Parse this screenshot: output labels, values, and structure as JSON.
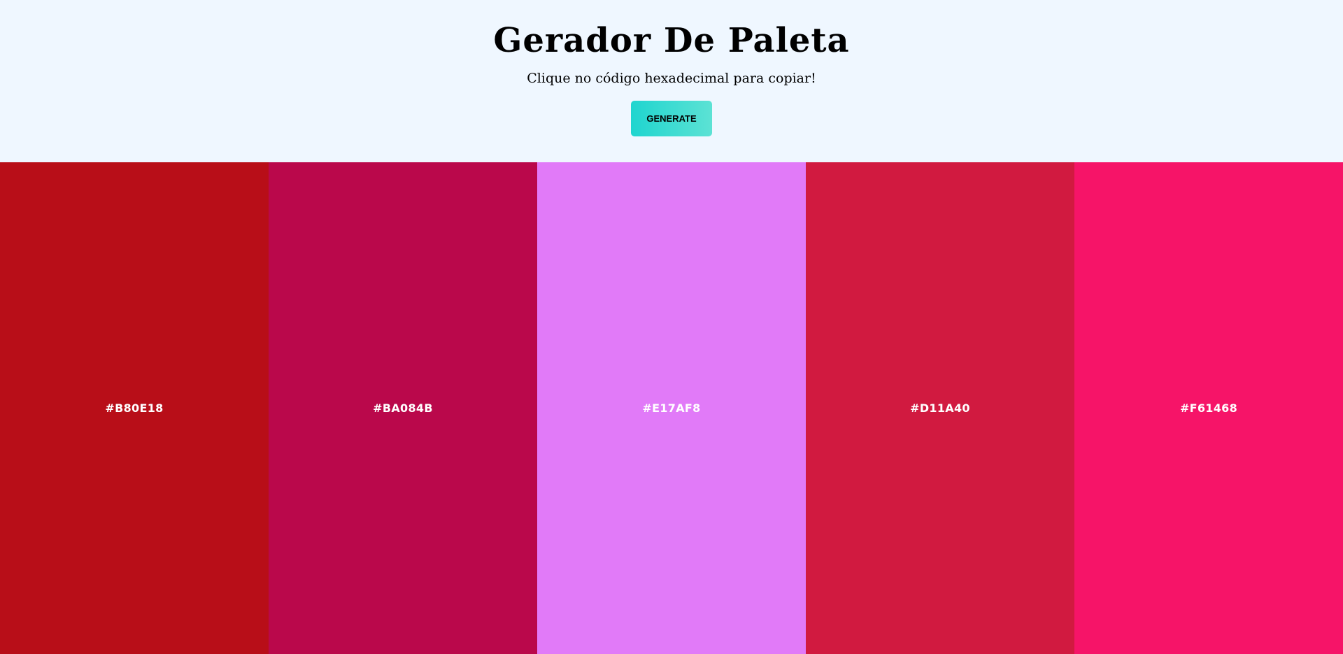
{
  "header": {
    "title": "Gerador De Paleta",
    "subtitle": "Clique no código hexadecimal para copiar!",
    "generate_label": "GENERATE",
    "background_color": "#eff7ff",
    "button_gradient": [
      "#1fd5cf",
      "#5ce2d4"
    ]
  },
  "palette": {
    "swatches": [
      {
        "hex": "#B80E18",
        "color": "#b80e18"
      },
      {
        "hex": "#BA084B",
        "color": "#ba084b"
      },
      {
        "hex": "#E17AF8",
        "color": "#e17af8"
      },
      {
        "hex": "#D11A40",
        "color": "#d11a40"
      },
      {
        "hex": "#F61468",
        "color": "#f61468"
      }
    ]
  }
}
